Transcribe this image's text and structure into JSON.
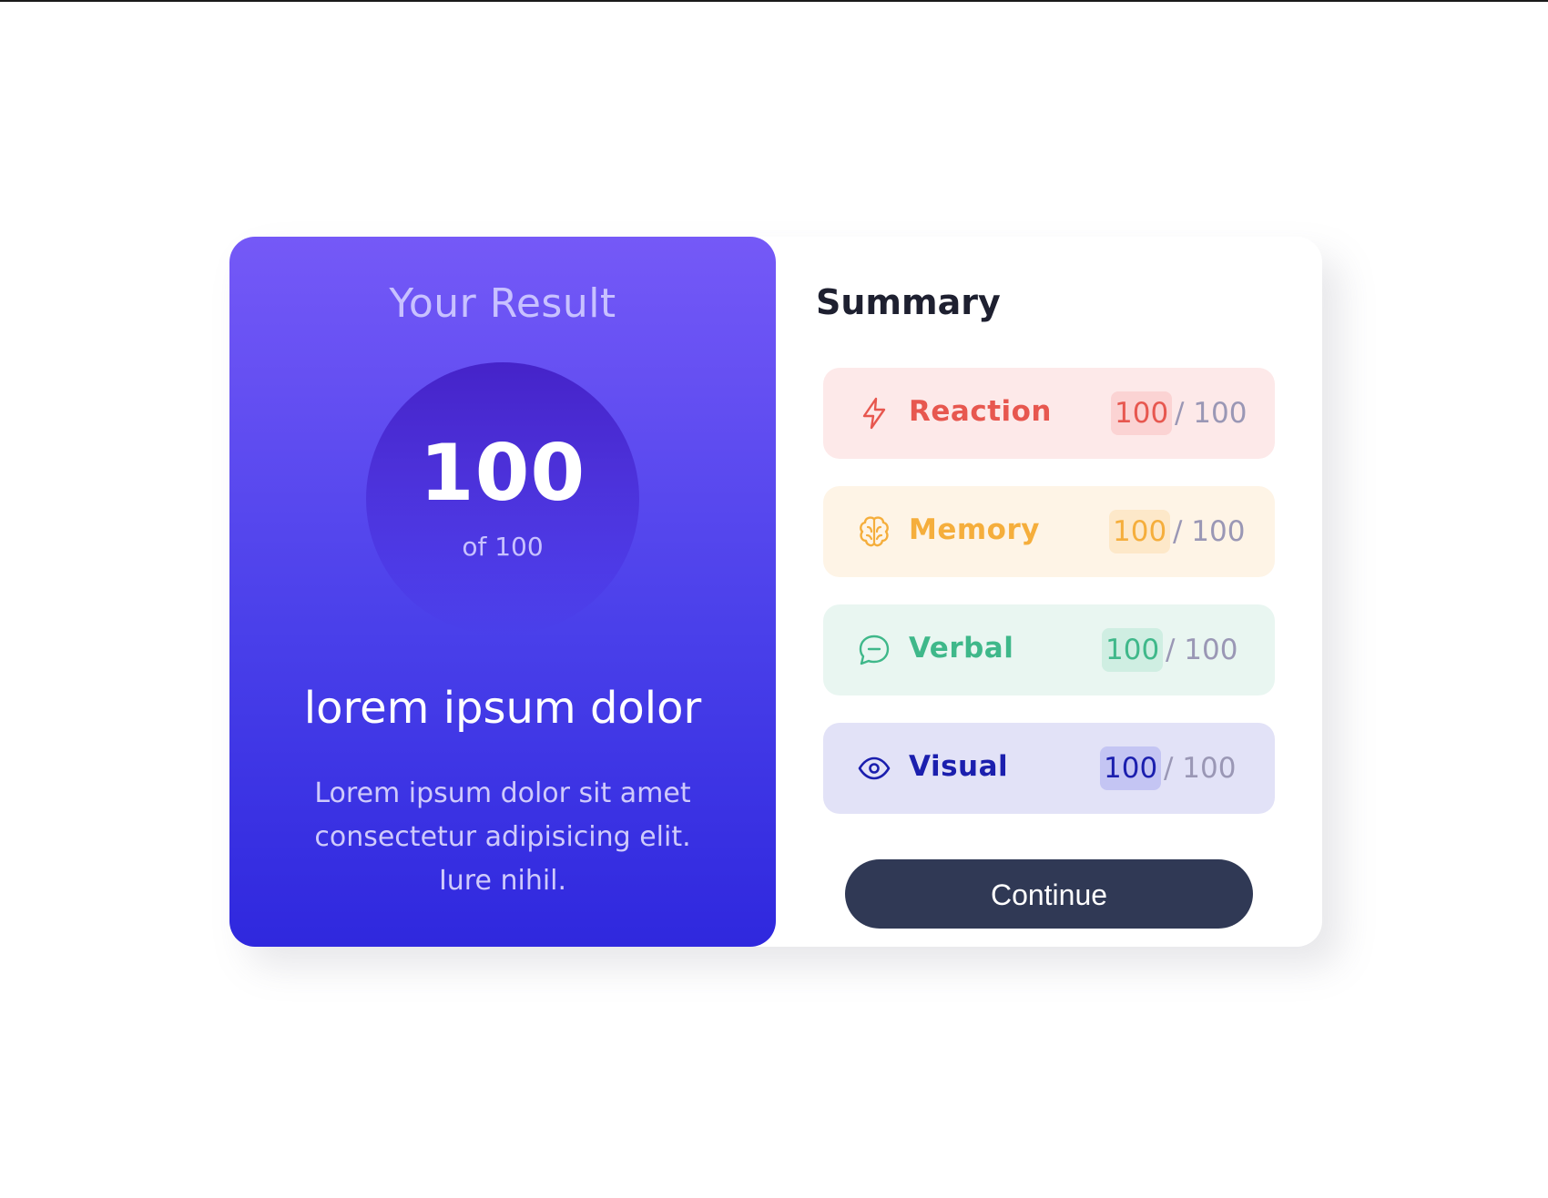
{
  "result": {
    "title": "Your Result",
    "score": "100",
    "score_of": "of 100",
    "heading": "lorem ipsum dolor",
    "description": "Lorem ipsum dolor sit amet consectetur adipisicing elit. Iure nihil."
  },
  "summary": {
    "title": "Summary",
    "items": [
      {
        "label": "Reaction",
        "value": "100",
        "total": "/ 100",
        "icon": "lightning-icon",
        "color": "#e7574f"
      },
      {
        "label": "Memory",
        "value": "100",
        "total": "/ 100",
        "icon": "brain-icon",
        "color": "#f5ae3c"
      },
      {
        "label": "Verbal",
        "value": "100",
        "total": "/ 100",
        "icon": "chat-bubble-icon",
        "color": "#3fb88a"
      },
      {
        "label": "Visual",
        "value": "100",
        "total": "/ 100",
        "icon": "eye-icon",
        "color": "#1b1fae"
      }
    ],
    "continue_label": "Continue"
  },
  "colors": {
    "gradient_top": "#7559f7",
    "gradient_bottom": "#2f28de",
    "button": "#303955"
  }
}
